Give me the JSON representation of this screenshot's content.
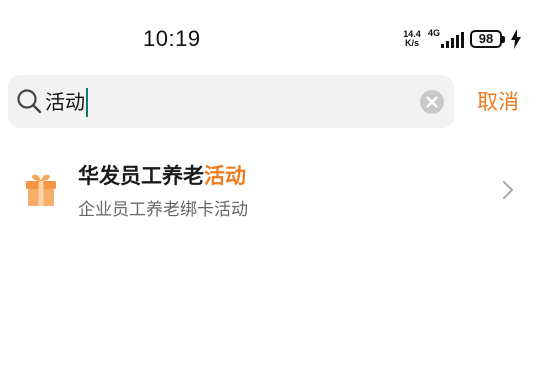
{
  "status_bar": {
    "time": "10:19",
    "net_speed_value": "14.4",
    "net_speed_unit": "K/s",
    "network_type": "4G",
    "battery": "98"
  },
  "search": {
    "value": "活动",
    "cancel_label": "取消",
    "icons": [
      "search-icon",
      "clear-icon"
    ]
  },
  "results": [
    {
      "icon": "gift-icon",
      "title_prefix": "华发员工养老",
      "title_highlight": "活动",
      "subtitle": "企业员工养老绑卡活动"
    }
  ],
  "colors": {
    "accent": "#f07a1e",
    "caret": "#0f7a6e",
    "search_bg": "#f2f2f2"
  }
}
